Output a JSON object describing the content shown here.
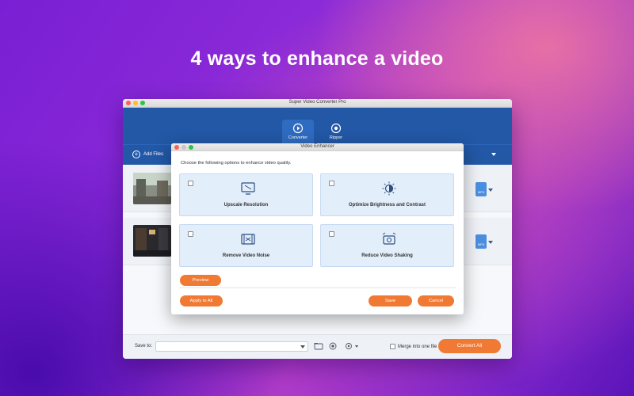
{
  "headline": "4 ways to enhance a video",
  "app": {
    "title": "Super Video Converter Pro",
    "nav": [
      {
        "label": "Converter",
        "active": true
      },
      {
        "label": "Ripper",
        "active": false
      }
    ],
    "add_files": "Add Files",
    "bottom": {
      "save_to": "Save to:",
      "merge_label": "Merge into one file",
      "convert_all": "Convert All"
    },
    "format_badge": "MP4"
  },
  "dialog": {
    "title": "Video Enhancer",
    "instruction": "Choose the following options to enhance video quality.",
    "options": [
      {
        "label": "Upscale Resolution",
        "icon": "monitor-icon"
      },
      {
        "label": "Optimize Brightness and Contrast",
        "icon": "brightness-icon"
      },
      {
        "label": "Remove Video Noise",
        "icon": "film-icon"
      },
      {
        "label": "Reduce Video Shaking",
        "icon": "stabilize-icon"
      }
    ],
    "preview": "Preview",
    "apply_all": "Apply to All",
    "save": "Save",
    "cancel": "Cancel"
  },
  "colors": {
    "accent_orange": "#f07a33",
    "nav_blue": "#2258a6",
    "option_bg": "#e3eefb"
  }
}
